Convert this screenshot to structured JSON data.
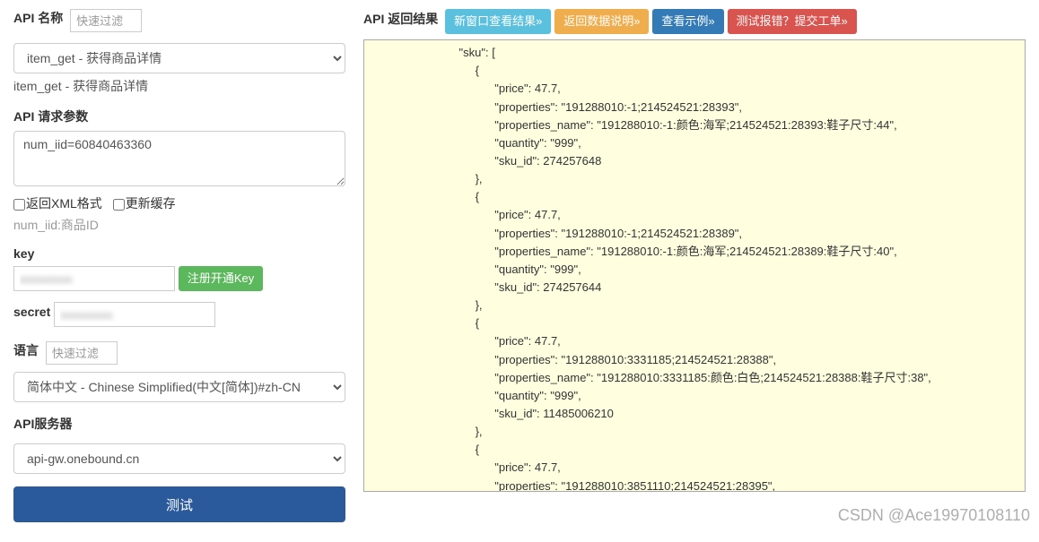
{
  "left": {
    "api_name_label": "API 名称",
    "api_name_filter_placeholder": "快速过滤",
    "api_select_value": "item_get - 获得商品详情",
    "api_select_help": "item_get - 获得商品详情",
    "api_params_label": "API 请求参数",
    "api_params_value": "num_iid=60840463360",
    "checkbox_xml_label": "返回XML格式",
    "checkbox_refresh_label": "更新缓存",
    "params_help": "num_iid:商品ID",
    "key_label": "key",
    "key_value": "xxxxxxxxx",
    "key_register_btn": "注册开通Key",
    "secret_label": "secret",
    "secret_value": "xxxxxxxxx",
    "lang_label": "语言",
    "lang_filter_placeholder": "快速过滤",
    "lang_select_value": "简体中文 - Chinese Simplified(中文[简体])#zh-CN",
    "server_label": "API服务器",
    "server_select_value": "api-gw.onebound.cn",
    "test_btn": "测试"
  },
  "right": {
    "result_label": "API 返回结果",
    "btn_new_window": "新窗口查看结果»",
    "btn_return_desc": "返回数据说明»",
    "btn_view_example": "查看示例»",
    "btn_report_error": "测试报错？提交工单»",
    "result_json": "                           \"sku\": [\n                                {\n                                      \"price\": 47.7,\n                                      \"properties\": \"191288010:-1;214524521:28393\",\n                                      \"properties_name\": \"191288010:-1:颜色:海军;214524521:28393:鞋子尺寸:44\",\n                                      \"quantity\": \"999\",\n                                      \"sku_id\": 274257648\n                                },\n                                {\n                                      \"price\": 47.7,\n                                      \"properties\": \"191288010:-1;214524521:28389\",\n                                      \"properties_name\": \"191288010:-1:颜色:海军;214524521:28389:鞋子尺寸:40\",\n                                      \"quantity\": \"999\",\n                                      \"sku_id\": 274257644\n                                },\n                                {\n                                      \"price\": 47.7,\n                                      \"properties\": \"191288010:3331185;214524521:28388\",\n                                      \"properties_name\": \"191288010:3331185:颜色:白色;214524521:28388:鞋子尺寸:38\",\n                                      \"quantity\": \"999\",\n                                      \"sku_id\": 11485006210\n                                },\n                                {\n                                      \"price\": 47.7,\n                                      \"properties\": \"191288010:3851110;214524521:28395\","
  },
  "watermark": "CSDN @Ace19970108110"
}
